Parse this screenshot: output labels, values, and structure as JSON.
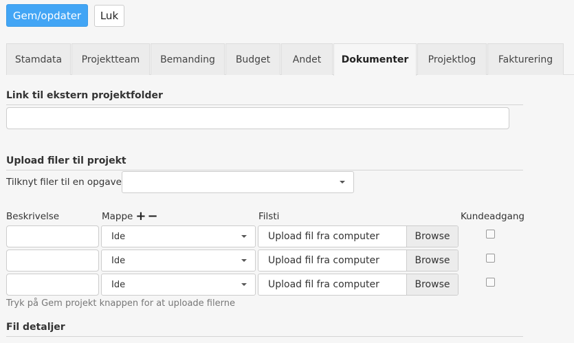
{
  "toolbar": {
    "save_label": "Gem/opdater",
    "close_label": "Luk"
  },
  "tabs": [
    {
      "label": "Stamdata"
    },
    {
      "label": "Projektteam"
    },
    {
      "label": "Bemanding"
    },
    {
      "label": "Budget"
    },
    {
      "label": "Andet"
    },
    {
      "label": "Dokumenter",
      "active": true
    },
    {
      "label": "Projektlog"
    },
    {
      "label": "Fakturering"
    }
  ],
  "external_link": {
    "title": "Link til ekstern projektfolder",
    "value": ""
  },
  "upload": {
    "title": "Upload filer til projekt",
    "task_label": "Tilknyt filer til en opgave",
    "task_value": "",
    "columns": {
      "description": "Beskrivelse",
      "folder": "Mappe",
      "filepath": "Filsti",
      "customer_access": "Kundeadgang"
    },
    "folder_add": "+",
    "folder_remove": "−",
    "rows": [
      {
        "description": "",
        "folder": "Ide",
        "file_text": "Upload fil fra computer",
        "browse": "Browse",
        "customer_access": false
      },
      {
        "description": "",
        "folder": "Ide",
        "file_text": "Upload fil fra computer",
        "browse": "Browse",
        "customer_access": false
      },
      {
        "description": "",
        "folder": "Ide",
        "file_text": "Upload fil fra computer",
        "browse": "Browse",
        "customer_access": false
      }
    ],
    "hint": "Tryk på Gem projekt knappen for at uploade filerne"
  },
  "file_details": {
    "title": "Fil detaljer"
  }
}
